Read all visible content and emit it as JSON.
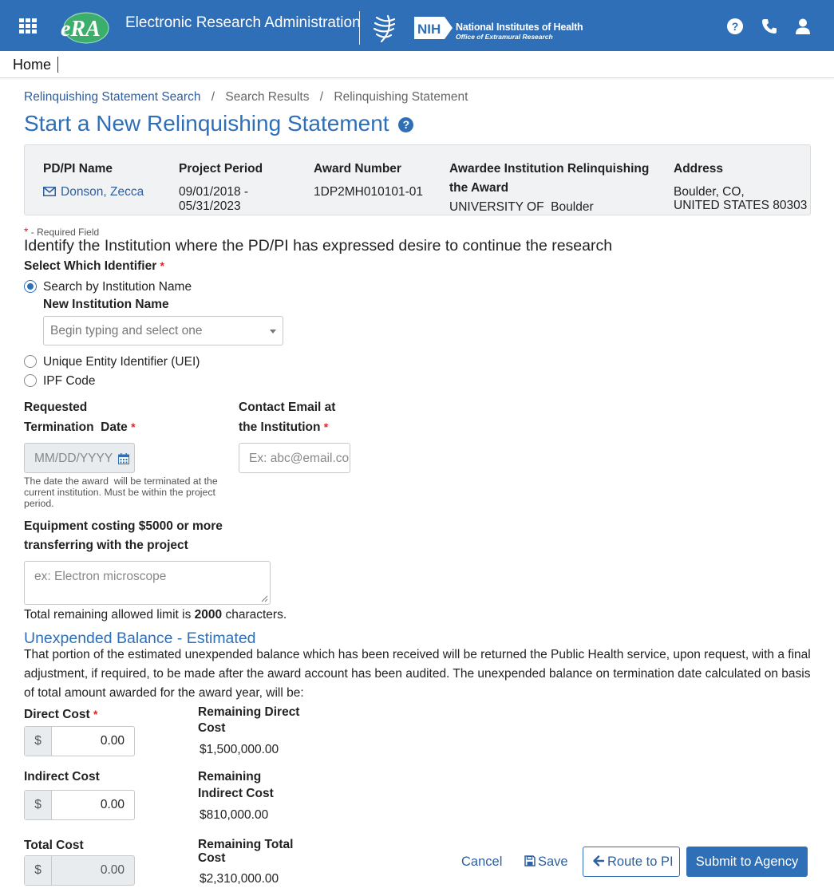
{
  "header": {
    "app_title": "Electronic Research Administration",
    "logo_text": "eRA",
    "nih_badge": "NIH",
    "nih_name": "National Institutes of Health",
    "nih_subtitle": "Office of Extramural Research",
    "brand_color": "#2e6fb8",
    "icons": [
      "apps-grid-icon",
      "help-icon",
      "phone-icon",
      "user-icon"
    ]
  },
  "nav": {
    "home_label": "Home"
  },
  "breadcrumb": {
    "items": [
      "Relinquishing Statement Search",
      "Search Results",
      "Relinquishing Statement"
    ],
    "separator": "/"
  },
  "page_title": "Start a New Relinquishing Statement",
  "summary": {
    "pi_label": "PD/PI Name",
    "pi_value": "Donson, Zecca",
    "period_label": "Project Period",
    "period_start": "09/01/2018 -",
    "period_end": "05/31/2023",
    "award_label": "Award Number",
    "award_value": "1DP2MH010101-01",
    "institution_label_line1": "Awardee Institution Relinquishing",
    "institution_label_line2": "the Award",
    "institution_value": "UNIVERSITY OF  Boulder",
    "address_label": "Address",
    "address_line1": "Boulder, CO,",
    "address_line2": "UNITED STATES 80303"
  },
  "form": {
    "required_marker": "*",
    "required_note": " - Required Field",
    "section_title": "Identify the Institution where the PD/PI has expressed desire to continue the research",
    "identifier_label": "Select Which Identifier",
    "identifier_options": [
      {
        "label": "Search by Institution Name",
        "selected": true
      },
      {
        "label": "Unique Entity Identifier (UEI)",
        "selected": false
      },
      {
        "label": "IPF Code",
        "selected": false
      }
    ],
    "institution_name_label": "New Institution Name",
    "institution_placeholder": "Begin typing and select one",
    "termination_label_line1": "Requested",
    "termination_label_line2": "Termination  Date",
    "termination_placeholder": "MM/DD/YYYY",
    "termination_hint_line1": "The date the award  will be terminated at the",
    "termination_hint_line2": "current institution. Must",
    "termination_hint_line3": "be within the project",
    "termination_hint_line4": "period.",
    "email_label_line1": "Contact Email at",
    "email_label_line2": "the Institution",
    "email_placeholder": "Ex: abc@email.com",
    "equipment_label_line1": "Equipment costing $5000 or more",
    "equipment_label_line2": "transferring with the project",
    "equipment_placeholder": "ex: Electron microscope",
    "limit_prefix": "Total remaining allowed limit is",
    "limit_value": "2000",
    "limit_suffix": "characters."
  },
  "balance": {
    "title": "Unexpended Balance - Estimated",
    "description": "That portion of the estimated unexpended balance which has been received will be returned the Public Health service, upon request, with a final adjustment, if required, to be made after the award account has been audited. The unexpended balance on termination date calculated on basis of total amount awarded for the award year, will be:",
    "currency_symbol": "$",
    "direct_cost_label": "Direct Cost",
    "direct_cost_value": "0.00",
    "remaining_direct_label_line1": "Remaining Direct",
    "remaining_direct_label_line2": "Cost",
    "remaining_direct_value": "$1,500,000.00",
    "indirect_cost_label": "Indirect Cost",
    "indirect_cost_value": "0.00",
    "remaining_indirect_label_line1": "Remaining",
    "remaining_indirect_label_line2": "Indirect Cost",
    "remaining_indirect_value": "$810,000.00",
    "total_cost_label": "Total Cost",
    "total_cost_value": "0.00",
    "remaining_total_label_line1": "Remaining Total",
    "remaining_total_label_line2": "Cost",
    "remaining_total_value": "$2,310,000.00"
  },
  "actions": {
    "cancel_label": "Cancel",
    "save_label": "Save",
    "route_label": "Route to PI",
    "submit_label": "Submit to Agency"
  }
}
